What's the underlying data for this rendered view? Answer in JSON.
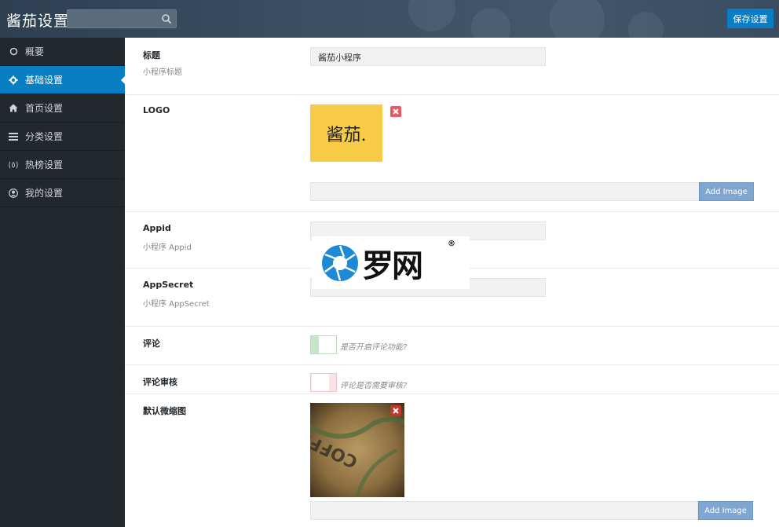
{
  "header": {
    "title": "酱茄设置",
    "search_placeholder": "",
    "save_label": "保存设置"
  },
  "sidebar": {
    "items": [
      {
        "label": "概要",
        "icon": "circle-icon"
      },
      {
        "label": "基础设置",
        "icon": "gear-icon",
        "active": true
      },
      {
        "label": "首页设置",
        "icon": "home-icon"
      },
      {
        "label": "分类设置",
        "icon": "list-icon"
      },
      {
        "label": "热榜设置",
        "icon": "fire-icon"
      },
      {
        "label": "我的设置",
        "icon": "user-icon"
      }
    ]
  },
  "form": {
    "title": {
      "label": "标题",
      "desc": "小程序标题",
      "value": "酱茄小程序"
    },
    "logo": {
      "label": "LOGO",
      "image_text": "酱茄.",
      "url_value": "",
      "add_label": "Add Image"
    },
    "appid": {
      "label": "Appid",
      "desc": "小程序 Appid",
      "value": ""
    },
    "appsecret": {
      "label": "AppSecret",
      "desc": "小程序 AppSecret",
      "value": ""
    },
    "comment": {
      "label": "评论",
      "hint": "是否开启评论功能?",
      "enabled": true
    },
    "comment_review": {
      "label": "评论审核",
      "hint": "评论是否需要审核?",
      "enabled": false
    },
    "thumbnail": {
      "label": "默认微缩图",
      "url_value": "",
      "add_label": "Add Image"
    }
  },
  "watermark": {
    "text": "罗网",
    "reg": "®"
  },
  "colors": {
    "accent": "#0a7ec4",
    "sidebar": "#23282d",
    "header": "#2e3f52",
    "logo_bg": "#f7cb45",
    "delete": "#e85865"
  }
}
